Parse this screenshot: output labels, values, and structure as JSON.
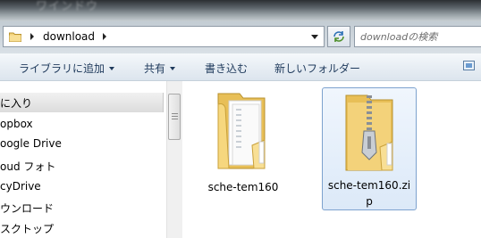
{
  "title_ghost": "ワインドウ　　",
  "address": {
    "path": [
      "download"
    ],
    "search_placeholder": "downloadの検索"
  },
  "toolbar": {
    "items": [
      {
        "label": "ライブラリに追加",
        "dropdown": true
      },
      {
        "label": "共有",
        "dropdown": true
      },
      {
        "label": "書き込む",
        "dropdown": false
      },
      {
        "label": "新しいフォルダー",
        "dropdown": false
      }
    ]
  },
  "nav": {
    "items": [
      {
        "label": "に入り",
        "selected": true
      },
      {
        "label": "opbox",
        "selected": false
      },
      {
        "label": "oogle Drive",
        "selected": false
      },
      {
        "label": "oud フォト",
        "selected": false
      },
      {
        "label": "cyDrive",
        "selected": false
      },
      {
        "label": "ウンロード",
        "selected": false
      },
      {
        "label": "スクトップ",
        "selected": false
      }
    ]
  },
  "files": [
    {
      "name": "sche-tem160",
      "type": "folder",
      "icon": "folder-icon",
      "selected": false
    },
    {
      "name": "sche-tem160.zi\np",
      "type": "zip",
      "icon": "zip-folder-icon",
      "selected": true
    }
  ],
  "colors": {
    "command_text": "#1e395b",
    "selection_border": "#7da2ce",
    "folder_yellow": "#f3d27a"
  }
}
